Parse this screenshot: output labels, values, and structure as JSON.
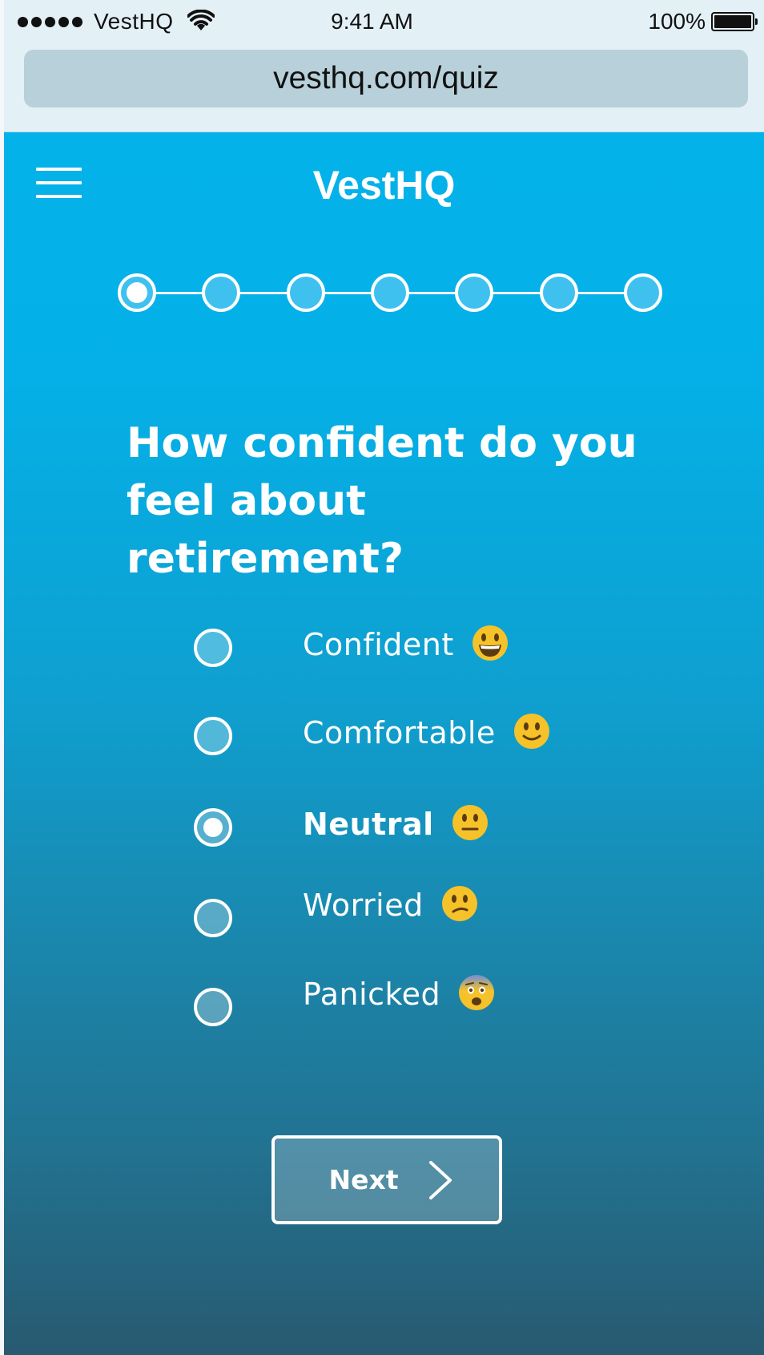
{
  "status_bar": {
    "carrier": "VestHQ",
    "time": "9:41 AM",
    "battery_percent": "100%",
    "signal_bars": 5,
    "battery_level": 1.0
  },
  "browser": {
    "url": "vesthq.com/quiz"
  },
  "header": {
    "logo": "VestHQ",
    "menu_icon": "hamburger-menu-icon"
  },
  "progress": {
    "total_steps": 7,
    "current_step": 1
  },
  "question": {
    "line1": "How confident do you",
    "line2": "feel about retirement?"
  },
  "options": [
    {
      "label": "Confident",
      "emoji": "grinning-face",
      "selected": false
    },
    {
      "label": "Comfortable",
      "emoji": "slightly-smiling-face",
      "selected": false
    },
    {
      "label": "Neutral",
      "emoji": "neutral-face",
      "selected": true
    },
    {
      "label": "Worried",
      "emoji": "confused-face",
      "selected": false
    },
    {
      "label": "Panicked",
      "emoji": "anxious-face",
      "selected": false
    }
  ],
  "next_button": {
    "label": "Next",
    "icon": "chevron-right-icon"
  },
  "colors": {
    "gradient_top": "#04b2ea",
    "gradient_bottom": "#285a70",
    "emoji_yellow": "#f6c229"
  }
}
